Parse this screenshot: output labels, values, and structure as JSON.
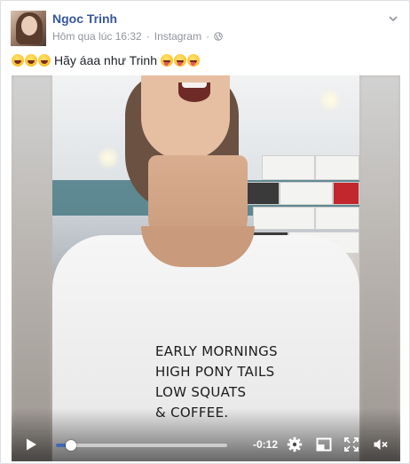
{
  "post": {
    "author": "Ngoc Trinh",
    "timestamp": "Hôm qua lúc 16:32",
    "separator": "·",
    "source": "Instagram",
    "privacy_icon": "globe-icon",
    "menu_icon": "chevron-down-icon",
    "caption_text": "Hãy áaa như Trinh",
    "caption_emoji_before": [
      "grinning-tears-emoji",
      "grinning-tears-emoji",
      "grinning-tears-emoji"
    ],
    "caption_emoji_after": [
      "tongue-out-emoji",
      "tongue-out-emoji",
      "tongue-out-emoji"
    ]
  },
  "video": {
    "shirt_lines": [
      "EARLY MORNINGS",
      "HIGH PONY TAILS",
      "LOW SQUATS",
      "& COFFEE."
    ],
    "controls": {
      "play_icon": "play-icon",
      "progress_fraction": 0.09,
      "time_remaining": "-0:12",
      "settings_icon": "gear-icon",
      "pip_icon": "pip-icon",
      "fullscreen_icon": "fullscreen-icon",
      "volume_icon": "mute-icon"
    }
  },
  "colors": {
    "link_blue": "#365899",
    "meta_gray": "#90949c",
    "progress_blue": "#4267b2"
  }
}
